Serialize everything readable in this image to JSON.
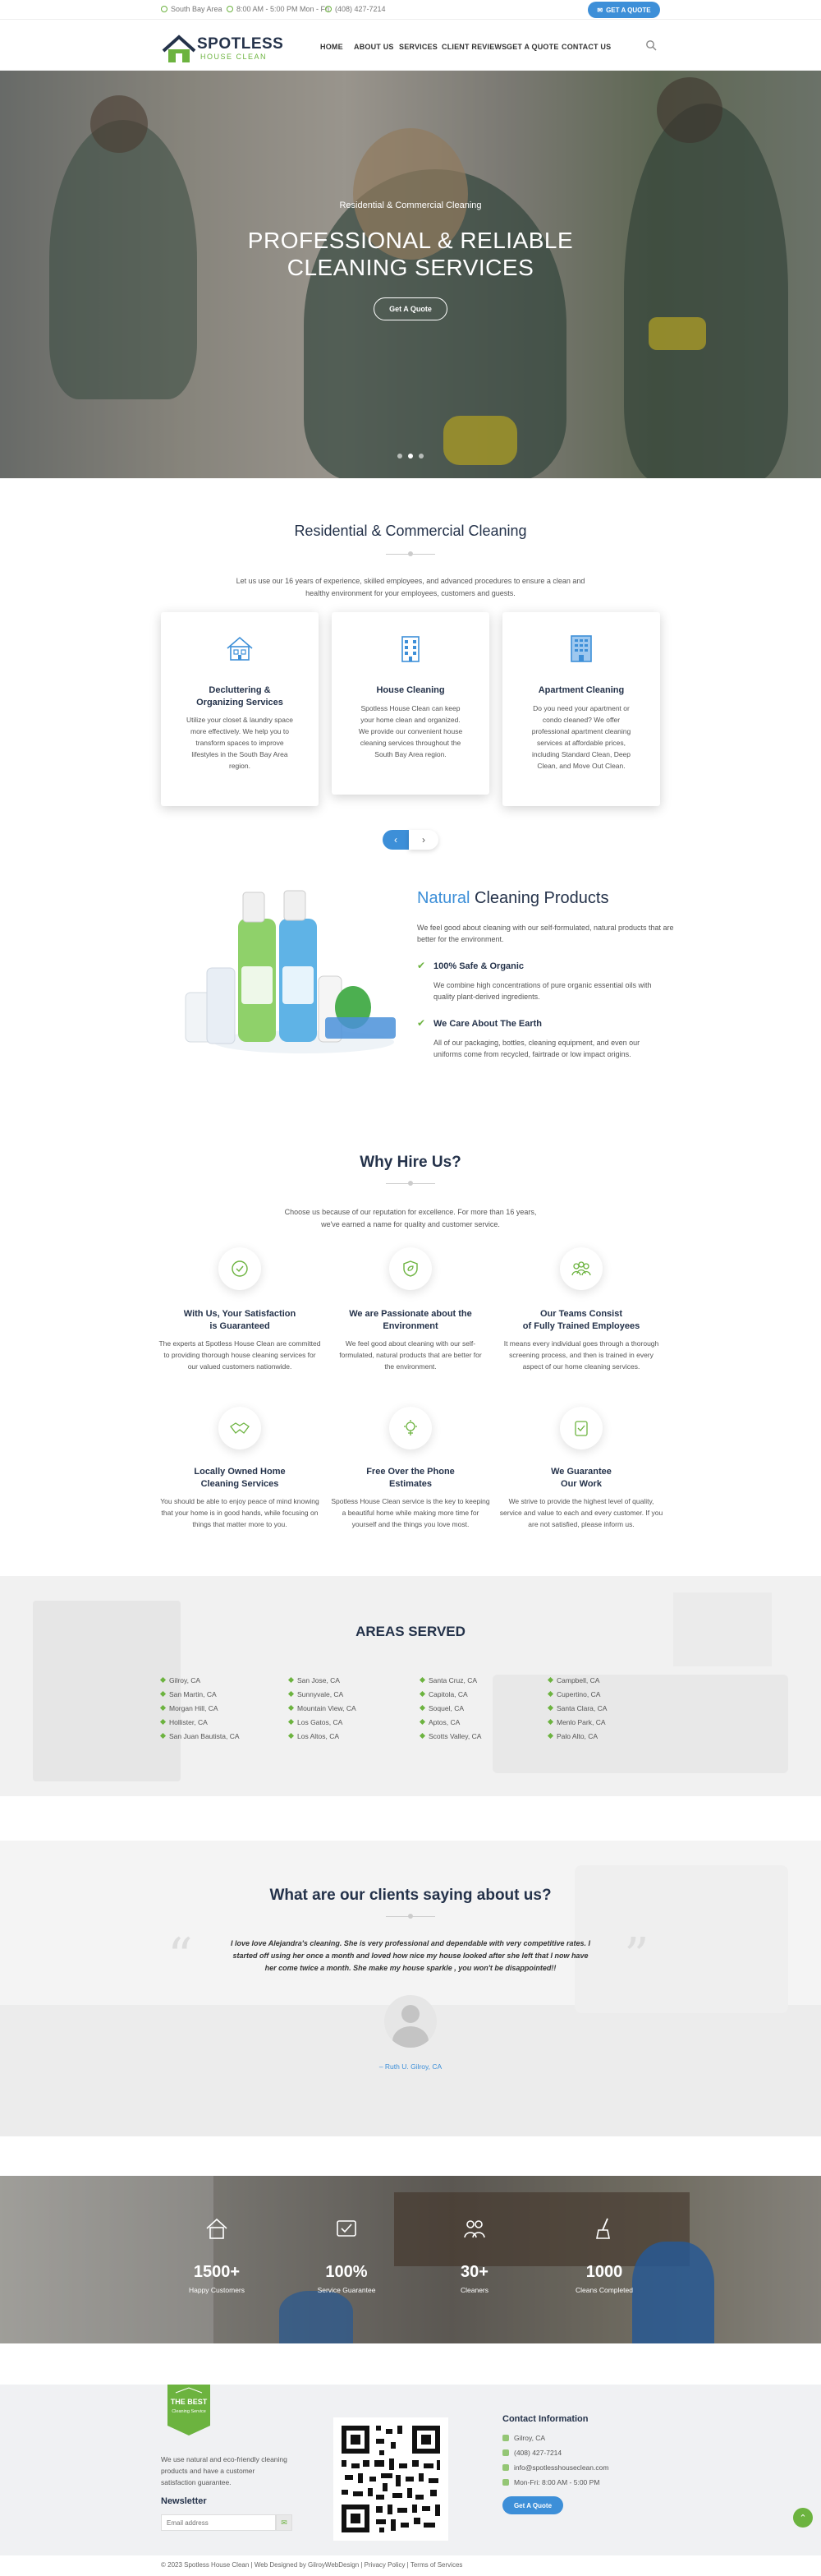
{
  "topbar": {
    "location": "South Bay Area",
    "hours": "8:00 AM - 5:00 PM Mon - Fri",
    "phone": "(408) 427-7214",
    "quote_button": "GET A QUOTE"
  },
  "header": {
    "logo_line1": "SPOTLESS",
    "logo_line2": "HOUSE CLEAN",
    "nav": [
      "HOME",
      "ABOUT US",
      "SERVICES",
      "CLIENT REVIEWS",
      "GET A QUOTE",
      "CONTACT US"
    ],
    "active_nav": "HOME"
  },
  "hero": {
    "subtitle": "Residential & Commercial Cleaning",
    "title_line1": "PROFESSIONAL & RELIABLE",
    "title_line2": "CLEANING SERVICES",
    "button": "Get A Quote",
    "active_slide": 2,
    "slide_count": 3
  },
  "services": {
    "title": "Residential & Commercial Cleaning",
    "intro_line1": "Let us use our 16 years of experience, skilled employees, and advanced procedures to ensure a clean and",
    "intro_line2": "healthy environment for your employees, customers and guests.",
    "cards": [
      {
        "icon": "house-icon",
        "title1": "Decluttering &",
        "title2": "Organizing Services",
        "lines": [
          "Utilize your closet & laundry space",
          "more effectively. We help you to",
          "transform spaces to improve",
          "lifestyles in the South Bay Area",
          "region."
        ]
      },
      {
        "icon": "building-icon",
        "title1": "House Cleaning",
        "title2": "",
        "lines": [
          "Spotless House Clean can keep",
          "your home clean and organized.",
          "We provide our convenient house",
          "cleaning services throughout the",
          "South Bay Area region."
        ]
      },
      {
        "icon": "apartment-icon",
        "title1": "Apartment Cleaning",
        "title2": "",
        "lines": [
          "Do you need your apartment or",
          "condo cleaned? We offer",
          "professional apartment cleaning",
          "services at affordable prices,",
          "including Standard Clean, Deep",
          "Clean, and Move Out Clean."
        ]
      }
    ],
    "prev": "‹",
    "next": "›"
  },
  "natural": {
    "title_accent": "Natural",
    "title_rest": "Cleaning Products",
    "intro_line1": "We feel good about cleaning with our self-formulated, natural products that are",
    "intro_line2": "better for the environment.",
    "items": [
      {
        "title": "100% Safe & Organic",
        "lines": [
          "We combine high concentrations of pure organic essential oils with",
          "quality plant-derived ingredients."
        ]
      },
      {
        "title": "We Care About The Earth",
        "lines": [
          "All of our packaging, bottles, cleaning equipment, and even our",
          "uniforms come from recycled, fairtrade or low impact origins."
        ]
      }
    ]
  },
  "why": {
    "title": "Why Hire Us?",
    "intro_line1": "Choose us because of our reputation for excellence. For more than 16 years,",
    "intro_line2": "we've earned a name for quality and customer service.",
    "items": [
      {
        "icon": "satisfaction-icon",
        "title1": "With Us, Your Satisfaction",
        "title2": "is Guaranteed",
        "lines": [
          "The experts at Spotless House Clean are committed",
          "to providing thorough house cleaning services for",
          "our valued customers nationwide."
        ]
      },
      {
        "icon": "leaf-shield-icon",
        "title1": "We are Passionate about the",
        "title2": "Environment",
        "lines": [
          "We feel good about cleaning with our self-",
          "formulated, natural products that are better for",
          "the environment."
        ]
      },
      {
        "icon": "team-icon",
        "title1": "Our Teams Consist",
        "title2": "of Fully Trained Employees",
        "lines": [
          "It means every individual goes through a thorough",
          "screening process, and then is trained in every",
          "aspect of our home cleaning services."
        ]
      },
      {
        "icon": "handshake-icon",
        "title1": "Locally Owned Home",
        "title2": "Cleaning Services",
        "lines": [
          "You should be able to enjoy peace of mind knowing",
          "that your home is in good hands, while focusing on",
          "things that matter more to you."
        ]
      },
      {
        "icon": "phone-estimate-icon",
        "title1": "Free Over the Phone",
        "title2": "Estimates",
        "lines": [
          "Spotless House Clean service is the key to keeping",
          "a beautiful home while making more time for",
          "yourself and the things you love most."
        ]
      },
      {
        "icon": "guarantee-icon",
        "title1": "We Guarantee",
        "title2": "Our Work",
        "lines": [
          "We strive to provide the highest level of quality,",
          "service and value to each and every customer. If you",
          "are not satisfied, please inform us."
        ]
      }
    ]
  },
  "areas": {
    "title": "AREAS SERVED",
    "columns": [
      [
        "Gilroy, CA",
        "San Martin, CA",
        "Morgan Hill, CA",
        "Hollister, CA",
        "San Juan Bautista, CA"
      ],
      [
        "San Jose, CA",
        "Sunnyvale, CA",
        "Mountain View, CA",
        "Los Gatos, CA",
        "Los Altos, CA"
      ],
      [
        "Santa Cruz, CA",
        "Capitola, CA",
        "Soquel, CA",
        "Aptos, CA",
        "Scotts Valley, CA"
      ],
      [
        "Campbell, CA",
        "Cupertino, CA",
        "Santa Clara, CA",
        "Menlo Park, CA",
        "Palo Alto, CA"
      ]
    ]
  },
  "testimonials": {
    "title": "What are our clients saying about us?",
    "quote_line1": "I love love Alejandra's cleaning. She is very professional and dependable with very competitive rates. I",
    "quote_line2": "started off using her once a month and loved how nice my house looked after she left that I now have",
    "quote_line3": "her come twice a month. She make my house sparkle , you won't be disappointed!!",
    "author": "– Ruth U. Gilroy, CA"
  },
  "stats": [
    {
      "icon": "house-stat-icon",
      "number": "1500+",
      "label": "Happy Customers"
    },
    {
      "icon": "service-stat-icon",
      "number": "100%",
      "label": "Service Guarantee"
    },
    {
      "icon": "cleaners-stat-icon",
      "number": "30+",
      "label": "Cleaners"
    },
    {
      "icon": "broom-stat-icon",
      "number": "1000",
      "label": "Cleans Completed"
    }
  ],
  "footer": {
    "badge_line1": "THE BEST",
    "badge_line2": "Cleaning Service",
    "about_line1": "We use natural and eco-friendly cleaning",
    "about_line2": "products and have a customer",
    "about_line3": "satisfaction guarantee.",
    "newsletter_title": "Newsletter",
    "email_placeholder": "Email address",
    "contact_title": "Contact Information",
    "contact": [
      "Gilroy, CA",
      "(408) 427-7214",
      "info@spotlesshouseclean.com",
      "Mon-Fri: 8:00 AM - 5:00 PM"
    ],
    "quote_button": "Get A Quote",
    "copyright": "© 2023 Spotless House Clean | Web Designed by GilroyWebDesign | Privacy Policy | Terms of Services"
  },
  "colors": {
    "green": "#6cb33f",
    "blue": "#3d8fd8",
    "navy": "#24324a"
  }
}
